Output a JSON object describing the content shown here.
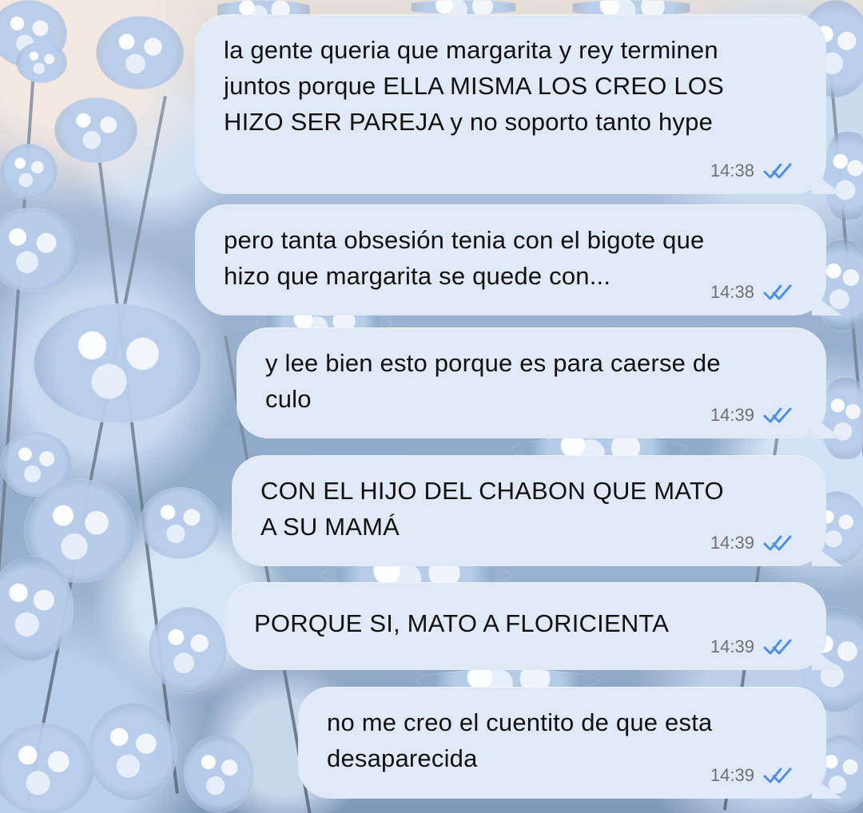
{
  "chat": {
    "messages": [
      {
        "text": "la gente queria que margarita y rey terminen juntos porque ELLA MISMA LOS CREO LOS HIZO SER PAREJA y no soporto tanto hype",
        "time": "14:38",
        "status_icon": "double-check-icon",
        "bubble_color": "#dfeaf6"
      },
      {
        "text": "pero tanta obsesión tenia con el bigote que hizo que margarita se quede con...",
        "time": "14:38",
        "status_icon": "double-check-icon",
        "bubble_color": "#dfeaf6"
      },
      {
        "text": "y lee bien esto porque es para caerse de culo",
        "time": "14:39",
        "status_icon": "double-check-icon",
        "bubble_color": "#dfeaf6"
      },
      {
        "text": "CON EL HIJO DEL CHABON QUE MATO A SU MAMÁ",
        "time": "14:39",
        "status_icon": "double-check-icon",
        "bubble_color": "#dfeaf6"
      },
      {
        "text": "PORQUE SI, MATO A FLORICIENTA",
        "time": "14:39",
        "status_icon": "double-check-icon",
        "bubble_color": "#dfeaf6"
      },
      {
        "text": "no me creo el cuentito de que esta desaparecida",
        "time": "14:39",
        "status_icon": "double-check-icon",
        "bubble_color": "#dfeaf6"
      }
    ],
    "check_color": "#4f8fe8"
  }
}
